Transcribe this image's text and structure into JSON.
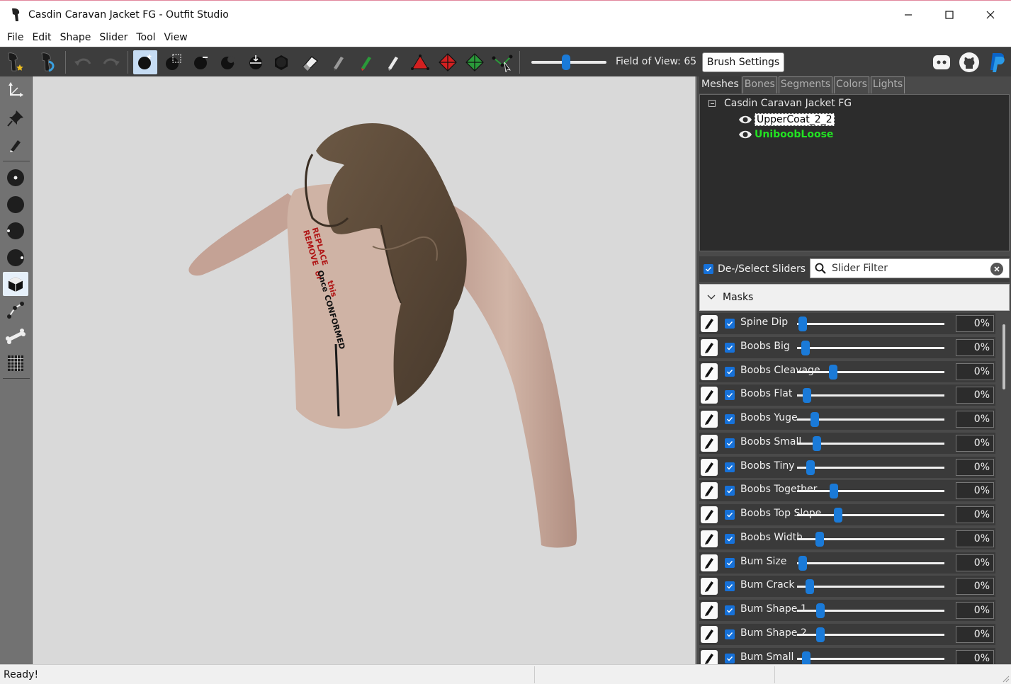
{
  "window": {
    "title": "Casdin Caravan Jacket FG - Outfit Studio",
    "controls": [
      "minimize-icon",
      "maximize-icon",
      "close-icon"
    ]
  },
  "menu": [
    "File",
    "Edit",
    "Shape",
    "Slider",
    "Tool",
    "View"
  ],
  "toolbar": {
    "field_of_view_label": "Field of View: 65",
    "field_of_view_level": 0.46,
    "brush_settings_label": "Brush Settings",
    "icons": [
      "load-outfit-icon",
      "save-outfit-icon",
      "undo-icon",
      "redo-icon",
      "inflate-brush-icon",
      "mask-select-icon",
      "deflate-brush-icon",
      "move-brush-icon",
      "smooth-brush-icon",
      "transform-brush-icon",
      "undiff-brush-icon",
      "eraser-icon",
      "weight-brush-icon",
      "color-brush-icon",
      "alpha-brush-icon",
      "collapse-vertex-icon",
      "flip-edge-icon",
      "split-edge-icon",
      "connect-points-icon"
    ],
    "social": [
      "discord-icon",
      "github-icon",
      "paypal-icon"
    ]
  },
  "left_tools": [
    "transform-tool-icon",
    "pivot-tool-icon",
    "vertex-edit-icon",
    "brush-small-icon",
    "brush-medium-icon",
    "brush-right-icon",
    "brush-half-icon",
    "cube-view-icon",
    "bone-curve-icon",
    "bone-icon",
    "grid-icon"
  ],
  "tabs": [
    "Meshes",
    "Bones",
    "Segments",
    "Colors",
    "Lights"
  ],
  "mesh_tree": {
    "root": "Casdin Caravan Jacket FG",
    "children": [
      {
        "name": "UpperCoat_2_2",
        "style": "selected"
      },
      {
        "name": "UniboobLoose",
        "style": "green"
      }
    ]
  },
  "slider_panel": {
    "deselect_label": "De-/Select Sliders",
    "filter_placeholder": "Slider Filter",
    "masks_label": "Masks"
  },
  "sliders": [
    {
      "name": "Spine Dip",
      "value": "0%",
      "level": 0.0
    },
    {
      "name": "Boobs Big",
      "value": "0%",
      "level": 0.0
    },
    {
      "name": "Boobs Cleavage",
      "value": "0%",
      "level": 0.0
    },
    {
      "name": "Boobs Flat",
      "value": "0%",
      "level": 0.0
    },
    {
      "name": "Boobs Yuge",
      "value": "0%",
      "level": 0.0
    },
    {
      "name": "Boobs Small",
      "value": "0%",
      "level": 0.0
    },
    {
      "name": "Boobs Tiny",
      "value": "0%",
      "level": 0.0
    },
    {
      "name": "Boobs Together",
      "value": "0%",
      "level": 0.0
    },
    {
      "name": "Boobs Top Slope",
      "value": "0%",
      "level": 0.0
    },
    {
      "name": "Boobs Width",
      "value": "0%",
      "level": 0.0
    },
    {
      "name": "Bum Size",
      "value": "0%",
      "level": 0.0
    },
    {
      "name": "Bum Crack",
      "value": "0%",
      "level": 0.0
    },
    {
      "name": "Bum Shape 1",
      "value": "0%",
      "level": 0.0
    },
    {
      "name": "Bum Shape 2",
      "value": "0%",
      "level": 0.0
    },
    {
      "name": "Bum Small",
      "value": "0%",
      "level": 0.0
    }
  ],
  "viewport": {
    "texture_text": [
      "REMOVE",
      "or",
      "REPLACE",
      "this",
      "Once",
      "CONFORMED"
    ]
  },
  "status": "Ready!",
  "colors": {
    "accent": "#1a7ad8",
    "toolbar_bg": "#3d3d3d",
    "viewport_bg": "#d9d9d9",
    "panel_bg": "#4a4a4a",
    "mesh_green": "#22e322"
  }
}
